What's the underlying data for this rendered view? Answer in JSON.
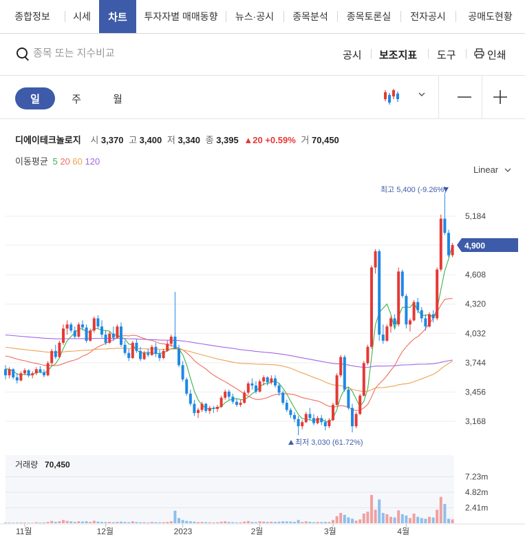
{
  "tabs": [
    {
      "label": "종합정보",
      "active": false
    },
    {
      "label": "시세",
      "active": false
    },
    {
      "label": "차트",
      "active": true
    },
    {
      "label": "투자자별 매매동향",
      "active": false
    },
    {
      "label": "뉴스·공시",
      "active": false
    },
    {
      "label": "종목분석",
      "active": false
    },
    {
      "label": "종목토론실",
      "active": false
    },
    {
      "label": "전자공시",
      "active": false
    },
    {
      "label": "공매도현황",
      "active": false
    }
  ],
  "search": {
    "placeholder": "종목 또는 지수비교"
  },
  "toolbar": {
    "disclosure": "공시",
    "indicators": "보조지표",
    "tools": "도구",
    "print": "인쇄"
  },
  "periods": {
    "day": "일",
    "week": "주",
    "month": "월",
    "active": "day"
  },
  "stock": {
    "name": "디에이테크놀로지",
    "open_label": "시",
    "open": "3,370",
    "high_label": "고",
    "high": "3,400",
    "low_label": "저",
    "low": "3,340",
    "close_label": "종",
    "close": "3,395",
    "change": "20",
    "change_pct": "+0.59%",
    "volume_label": "거",
    "volume": "70,450"
  },
  "moving_average": {
    "label": "이동평균",
    "periods": [
      {
        "label": "5",
        "color": "#3cb24a"
      },
      {
        "label": "20",
        "color": "#f06d5a"
      },
      {
        "label": "60",
        "color": "#f0a050"
      },
      {
        "label": "120",
        "color": "#a066e6"
      }
    ]
  },
  "scale": "Linear",
  "colors": {
    "up": "#e53935",
    "down": "#1e88e5",
    "accent": "#3d5ba9",
    "current_price_tag": "#3d5ba9"
  },
  "chart_data": {
    "type": "candlestick",
    "y_ticks": [
      "5,184",
      "4,900",
      "4,608",
      "4,320",
      "4,032",
      "3,744",
      "3,456",
      "3,168"
    ],
    "ylim": [
      3000,
      5500
    ],
    "x_tick_labels": [
      "11월",
      "12월",
      "2023",
      "2월",
      "3월",
      "4월"
    ],
    "current_price": 4900,
    "current_price_label": "4,900",
    "max_annotation": "최고 5,400 (-9.26%)",
    "min_annotation": "최저 3,030 (61.72%)",
    "max_value": 5400,
    "min_value": 3030,
    "candles": [
      [
        3680,
        3720,
        3580,
        3620
      ],
      [
        3620,
        3700,
        3590,
        3680
      ],
      [
        3680,
        3690,
        3580,
        3600
      ],
      [
        3600,
        3640,
        3540,
        3570
      ],
      [
        3570,
        3660,
        3560,
        3640
      ],
      [
        3640,
        3690,
        3620,
        3670
      ],
      [
        3670,
        3680,
        3600,
        3620
      ],
      [
        3620,
        3660,
        3590,
        3640
      ],
      [
        3640,
        3700,
        3620,
        3680
      ],
      [
        3680,
        3710,
        3640,
        3650
      ],
      [
        3650,
        3680,
        3600,
        3620
      ],
      [
        3620,
        3760,
        3610,
        3740
      ],
      [
        3740,
        3880,
        3720,
        3860
      ],
      [
        3860,
        3920,
        3780,
        3800
      ],
      [
        3800,
        3960,
        3790,
        3940
      ],
      [
        3940,
        4120,
        3920,
        4080
      ],
      [
        4080,
        4160,
        4020,
        4120
      ],
      [
        4120,
        4140,
        4040,
        4060
      ],
      [
        4060,
        4100,
        3980,
        4000
      ],
      [
        4000,
        4140,
        3990,
        4120
      ],
      [
        4120,
        4160,
        4060,
        4090
      ],
      [
        4090,
        4120,
        3940,
        3960
      ],
      [
        3960,
        4080,
        3950,
        4060
      ],
      [
        4060,
        4200,
        4040,
        4180
      ],
      [
        4180,
        4210,
        4080,
        4100
      ],
      [
        4100,
        4160,
        3990,
        4020
      ],
      [
        4020,
        4060,
        3920,
        3940
      ],
      [
        3940,
        4050,
        3930,
        4030
      ],
      [
        4030,
        4100,
        3960,
        3990
      ],
      [
        3990,
        4120,
        3980,
        4100
      ],
      [
        4100,
        4140,
        3900,
        3920
      ],
      [
        3920,
        3960,
        3820,
        3840
      ],
      [
        3840,
        3880,
        3760,
        3790
      ],
      [
        3790,
        3960,
        3780,
        3940
      ],
      [
        3940,
        3980,
        3840,
        3860
      ],
      [
        3860,
        3900,
        3760,
        3780
      ],
      [
        3780,
        3860,
        3770,
        3840
      ],
      [
        3840,
        3880,
        3800,
        3820
      ],
      [
        3820,
        3920,
        3810,
        3900
      ],
      [
        3900,
        3940,
        3800,
        3830
      ],
      [
        3830,
        3870,
        3760,
        3790
      ],
      [
        3790,
        3880,
        3780,
        3860
      ],
      [
        3860,
        3960,
        3850,
        3930
      ],
      [
        3930,
        4020,
        3900,
        4000
      ],
      [
        4000,
        4440,
        3880,
        3880
      ],
      [
        3880,
        3920,
        3700,
        3720
      ],
      [
        3720,
        3760,
        3560,
        3580
      ],
      [
        3580,
        3600,
        3420,
        3440
      ],
      [
        3440,
        3480,
        3320,
        3340
      ],
      [
        3340,
        3380,
        3220,
        3250
      ],
      [
        3250,
        3300,
        3200,
        3280
      ],
      [
        3280,
        3360,
        3260,
        3340
      ],
      [
        3340,
        3350,
        3250,
        3270
      ],
      [
        3270,
        3320,
        3240,
        3300
      ],
      [
        3300,
        3320,
        3250,
        3290
      ],
      [
        3290,
        3330,
        3260,
        3310
      ],
      [
        3310,
        3420,
        3300,
        3400
      ],
      [
        3400,
        3480,
        3380,
        3460
      ],
      [
        3460,
        3480,
        3380,
        3410
      ],
      [
        3410,
        3440,
        3340,
        3360
      ],
      [
        3360,
        3390,
        3310,
        3330
      ],
      [
        3330,
        3380,
        3310,
        3350
      ],
      [
        3350,
        3470,
        3340,
        3450
      ],
      [
        3450,
        3560,
        3430,
        3540
      ],
      [
        3540,
        3590,
        3480,
        3520
      ],
      [
        3520,
        3560,
        3440,
        3460
      ],
      [
        3460,
        3580,
        3450,
        3560
      ],
      [
        3560,
        3620,
        3520,
        3600
      ],
      [
        3600,
        3610,
        3520,
        3550
      ],
      [
        3550,
        3620,
        3530,
        3590
      ],
      [
        3590,
        3620,
        3500,
        3520
      ],
      [
        3520,
        3540,
        3420,
        3450
      ],
      [
        3450,
        3470,
        3330,
        3350
      ],
      [
        3350,
        3380,
        3260,
        3280
      ],
      [
        3280,
        3300,
        3200,
        3230
      ],
      [
        3230,
        3260,
        3160,
        3190
      ],
      [
        3190,
        3220,
        3030,
        3120
      ],
      [
        3120,
        3180,
        3090,
        3160
      ],
      [
        3160,
        3260,
        3150,
        3240
      ],
      [
        3240,
        3300,
        3180,
        3200
      ],
      [
        3200,
        3240,
        3130,
        3150
      ],
      [
        3150,
        3220,
        3140,
        3200
      ],
      [
        3200,
        3230,
        3130,
        3160
      ],
      [
        3160,
        3190,
        3080,
        3120
      ],
      [
        3120,
        3200,
        3100,
        3180
      ],
      [
        3180,
        3350,
        3170,
        3330
      ],
      [
        3330,
        3640,
        3320,
        3620
      ],
      [
        3620,
        3820,
        3600,
        3800
      ],
      [
        3800,
        3820,
        3460,
        3480
      ],
      [
        3480,
        3500,
        3280,
        3300
      ],
      [
        3300,
        3340,
        3060,
        3120
      ],
      [
        3120,
        3260,
        3100,
        3240
      ],
      [
        3240,
        3440,
        3230,
        3420
      ],
      [
        3420,
        3760,
        3410,
        3740
      ],
      [
        3740,
        3920,
        3720,
        3900
      ],
      [
        3900,
        4700,
        3880,
        4680
      ],
      [
        4680,
        4860,
        4620,
        4840
      ],
      [
        4840,
        4860,
        3960,
        4020
      ],
      [
        4020,
        4120,
        3930,
        3960
      ],
      [
        3960,
        4120,
        3950,
        4100
      ],
      [
        4100,
        4200,
        4040,
        4180
      ],
      [
        4180,
        4220,
        4080,
        4120
      ],
      [
        4120,
        4680,
        4100,
        4640
      ],
      [
        4640,
        4660,
        4380,
        4400
      ],
      [
        4400,
        4420,
        4080,
        4120
      ],
      [
        4120,
        4180,
        4050,
        4160
      ],
      [
        4160,
        4360,
        4150,
        4340
      ],
      [
        4340,
        4380,
        4230,
        4260
      ],
      [
        4260,
        4290,
        4140,
        4180
      ],
      [
        4180,
        4220,
        4060,
        4100
      ],
      [
        4100,
        4240,
        4090,
        4220
      ],
      [
        4220,
        4260,
        4140,
        4180
      ],
      [
        4180,
        4680,
        4160,
        4660
      ],
      [
        4660,
        5200,
        4640,
        5160
      ],
      [
        5160,
        5400,
        5000,
        5020
      ],
      [
        5020,
        5050,
        4780,
        4800
      ],
      [
        4800,
        4920,
        4780,
        4900
      ]
    ],
    "volume_ticks": [
      "7.23m",
      "4.82m",
      "2.41m"
    ],
    "volume_label": "거래량",
    "volume_value": "70,450",
    "volumes": [
      0.12,
      0.1,
      0.08,
      0.09,
      0.11,
      0.1,
      0.08,
      0.07,
      0.15,
      0.1,
      0.12,
      0.2,
      0.35,
      0.22,
      0.3,
      0.5,
      0.36,
      0.28,
      0.2,
      0.3,
      0.26,
      0.3,
      0.2,
      0.38,
      0.25,
      0.2,
      0.18,
      0.2,
      0.16,
      0.22,
      0.24,
      0.2,
      0.16,
      0.3,
      0.18,
      0.14,
      0.16,
      0.12,
      0.2,
      0.16,
      0.14,
      0.16,
      0.2,
      0.3,
      1.95,
      0.8,
      0.5,
      0.36,
      0.3,
      0.24,
      0.18,
      0.2,
      0.16,
      0.14,
      0.12,
      0.14,
      0.24,
      0.3,
      0.2,
      0.16,
      0.12,
      0.14,
      0.26,
      0.34,
      0.2,
      0.16,
      0.3,
      0.26,
      0.2,
      0.24,
      0.2,
      0.24,
      0.3,
      0.28,
      0.26,
      0.22,
      0.5,
      0.2,
      0.3,
      0.22,
      0.16,
      0.2,
      0.18,
      0.22,
      0.2,
      0.5,
      1.1,
      1.6,
      1.3,
      0.9,
      0.7,
      0.4,
      0.6,
      1.5,
      1.8,
      4.4,
      2.1,
      3.7,
      1.6,
      1.4,
      1.0,
      0.9,
      2.0,
      1.4,
      1.2,
      0.8,
      1.5,
      1.0,
      0.8,
      0.7,
      1.0,
      0.9,
      2.1,
      4.1,
      3.0,
      0.7,
      0.6
    ]
  }
}
